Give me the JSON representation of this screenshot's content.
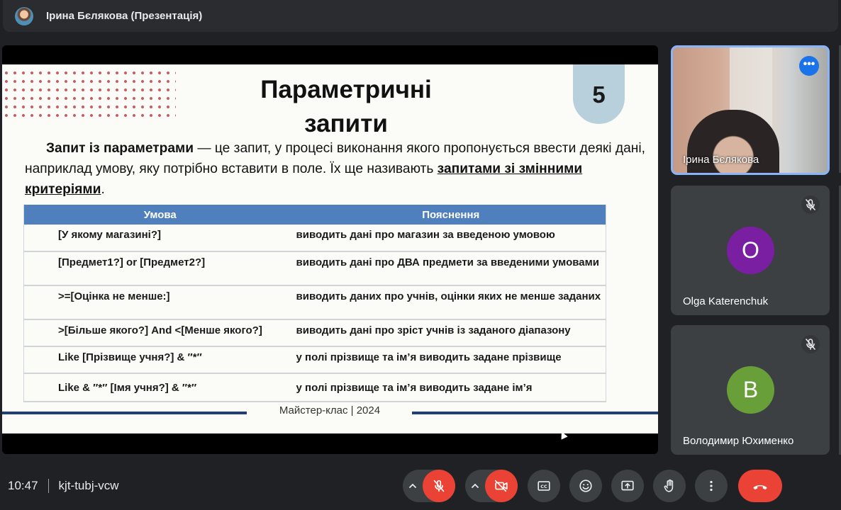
{
  "topbar": {
    "title": "Ірина Бєлякова (Презентація)"
  },
  "slide": {
    "title_line1": "Параметричні",
    "title_line2": "запити",
    "number": "5",
    "intro_bold": "Запит із параметрами",
    "intro_text": " — це запит, у процесі виконання якого пропонується ввести деякі дані, наприклад умову, яку потрібно вставити в поле. Їх ще називають ",
    "intro_underlined": "запитами зі змінними критеріями",
    "intro_end": ".",
    "table": {
      "headers": [
        "Умова",
        "Пояснення"
      ],
      "rows": [
        [
          "[У якому магазині?]",
          "виводить дані про магазин за введеною умовою"
        ],
        [
          "[Предмет1?] or [Предмет2?]",
          "виводить дані про ДВА предмети за введеними умовами"
        ],
        [
          ">=[Оцінка не менше:]",
          "виводить даних про учнів, оцінки яких не менше заданих"
        ],
        [
          ">[Більше якого?] And <[Менше якого?]",
          "виводить дані про зріст учнів із заданого діапазону"
        ],
        [
          "Like [Прізвище учня?] & ″*″",
          "у полі прізвище та ім’я виводить задане прізвище"
        ],
        [
          "Like & ″*″ [Імя учня?] & ″*″",
          "у полі прізвище та ім’я виводить задане ім’я"
        ]
      ]
    },
    "footer": "Майстер-клас | 2024"
  },
  "participants": [
    {
      "name": "Ірина Бєлякова",
      "type": "video",
      "more_label": "•••"
    },
    {
      "name": "Olga Katerenchuk",
      "initial": "O",
      "color": "#7b1fa2",
      "mic": "muted"
    },
    {
      "name": "Володимир Юхименко",
      "initial": "B",
      "color": "#689f38",
      "mic": "muted"
    }
  ],
  "bottombar": {
    "time": "10:47",
    "meeting_code": "kjt-tubj-vcw"
  },
  "icons": {
    "mic_muted": "mic-off-icon",
    "cam_off": "videocam-off-icon",
    "captions": "closed-caption-icon",
    "emoji": "emoji-icon",
    "present": "present-screen-icon",
    "hand": "raise-hand-icon",
    "more": "more-vert-icon",
    "end_call": "call-end-icon"
  },
  "colors": {
    "danger": "#ea4335",
    "accent": "#8ab4f8",
    "table_header": "#4f80bd"
  }
}
